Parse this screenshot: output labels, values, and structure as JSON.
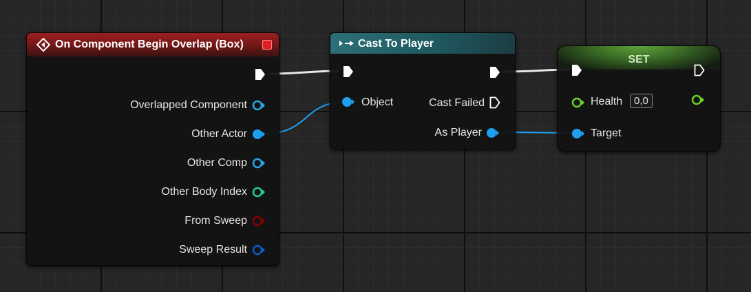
{
  "event_node": {
    "title": "On Component Begin Overlap (Box)",
    "header_color": "#9b1f1f",
    "outputs": [
      {
        "label": "Overlapped Component",
        "color": "#2aa6e8"
      },
      {
        "label": "Other Actor",
        "color": "#1ea0f0"
      },
      {
        "label": "Other Comp",
        "color": "#2aa6e8"
      },
      {
        "label": "Other Body Index",
        "color": "#1fcf9a"
      },
      {
        "label": "From Sweep",
        "color": "#8a0000"
      },
      {
        "label": "Sweep Result",
        "color": "#0a5cc8"
      }
    ]
  },
  "cast_node": {
    "title": "Cast To Player",
    "header_color": "#2d6f78",
    "input_object": "Object",
    "output_cast_failed": "Cast Failed",
    "output_as_player": "As Player"
  },
  "set_node": {
    "title": "SET",
    "header_color": "#5da33a",
    "health_label": "Health",
    "health_value": "0,0",
    "target_label": "Target"
  },
  "colors": {
    "object_pin": "#1ea0f0",
    "float_pin": "#6ad12a",
    "exec_pin": "#ffffff",
    "wire_exec": "#e8e8e8",
    "wire_object": "#1ea0f0"
  }
}
